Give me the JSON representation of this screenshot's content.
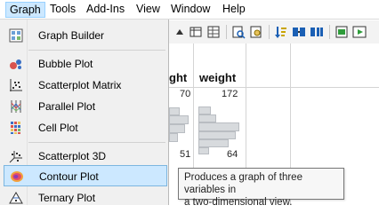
{
  "menubar": {
    "items": [
      {
        "label": "Graph"
      },
      {
        "label": "Tools"
      },
      {
        "label": "Add-Ins"
      },
      {
        "label": "View"
      },
      {
        "label": "Window"
      },
      {
        "label": "Help"
      }
    ]
  },
  "graph_menu": {
    "items": [
      {
        "label": "Graph Builder",
        "icon": "graph-builder-icon"
      },
      {
        "label": "Bubble Plot",
        "icon": "bubble-plot-icon"
      },
      {
        "label": "Scatterplot Matrix",
        "icon": "scatterplot-matrix-icon"
      },
      {
        "label": "Parallel Plot",
        "icon": "parallel-plot-icon"
      },
      {
        "label": "Cell Plot",
        "icon": "cell-plot-icon"
      },
      {
        "label": "Scatterplot 3D",
        "icon": "scatterplot-3d-icon"
      },
      {
        "label": "Contour Plot",
        "icon": "contour-plot-icon"
      },
      {
        "label": "Ternary Plot",
        "icon": "ternary-plot-icon"
      }
    ],
    "highlighted": "Contour Plot"
  },
  "table": {
    "columns": [
      {
        "header": "ght"
      },
      {
        "header": "weight"
      }
    ],
    "visible_values": {
      "height_top": "70",
      "weight_top": "172",
      "height_bottom": "51",
      "weight_bottom": "64"
    }
  },
  "tooltip": {
    "line1": "Produces a graph of three variables in",
    "line2": "a two-dimensional view."
  },
  "colors": {
    "highlight": "#cce8ff",
    "highlight_border": "#7cb6e0",
    "menu_bg": "#f0f0f0"
  }
}
